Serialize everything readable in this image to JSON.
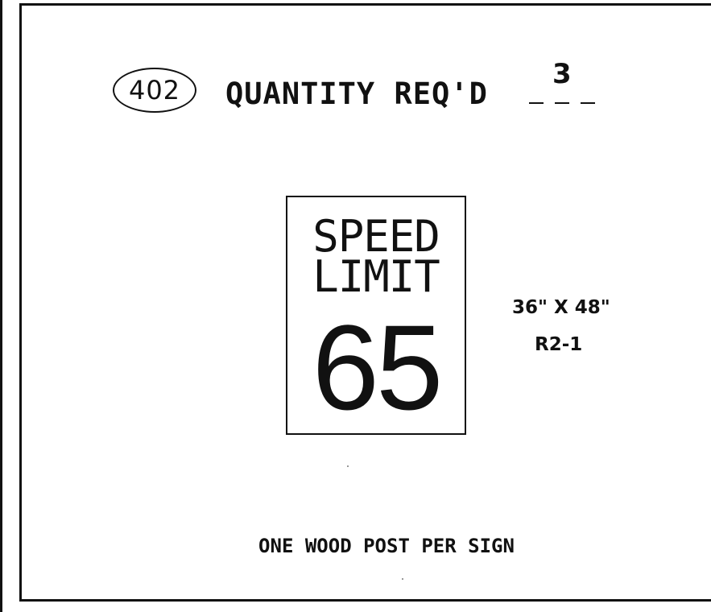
{
  "item_number": "402",
  "quantity": {
    "label": "QUANTITY REQ'D",
    "value": "3"
  },
  "sign": {
    "line1": "SPEED",
    "line2": "LIMIT",
    "number": "65",
    "size": "36\" X 48\"",
    "code": "R2-1"
  },
  "note": "ONE WOOD POST PER SIGN"
}
